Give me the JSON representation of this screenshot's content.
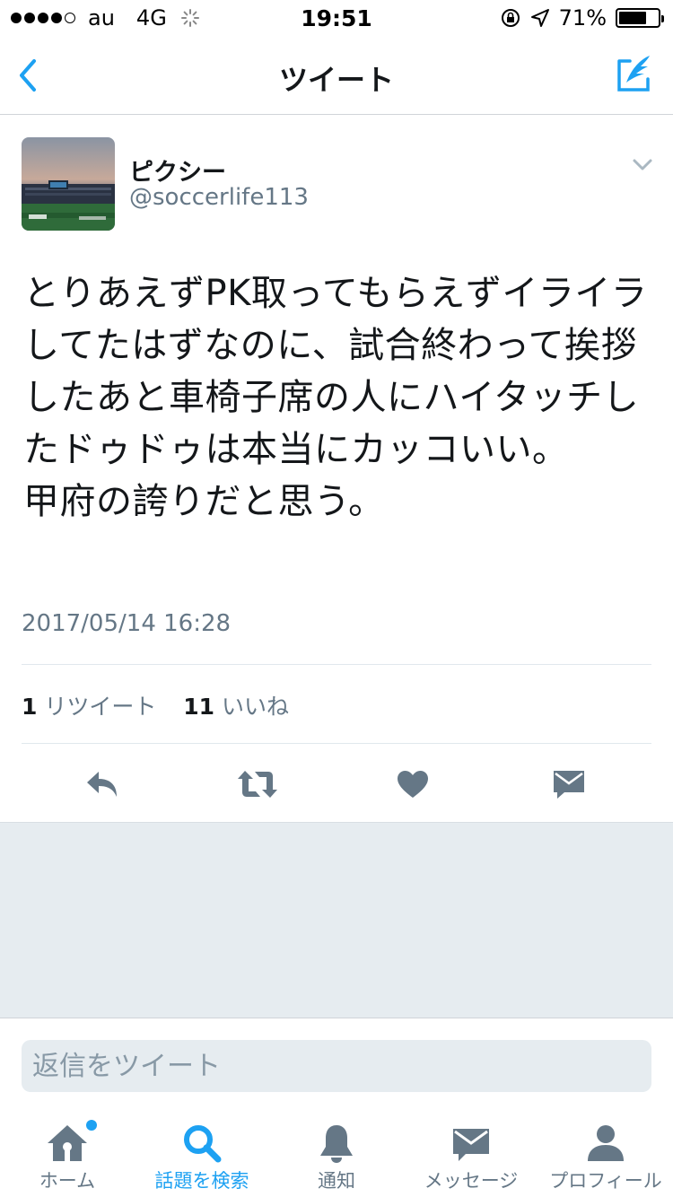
{
  "status_bar": {
    "carrier": "au",
    "network": "4G",
    "time": "19:51",
    "battery": "71%",
    "battery_level": 0.71,
    "signal_bars": 4
  },
  "nav": {
    "title": "ツイート",
    "back_icon": "chevron-left-icon",
    "compose_icon": "compose-tweet-icon"
  },
  "tweet": {
    "author_name": "ピクシー",
    "author_handle": "@soccerlife113",
    "text": "とりあえずPK取ってもらえずイライラしてたはずなのに、試合終わって挨拶したあと車椅子席の人にハイタッチしたドゥドゥは本当にカッコいい。\n甲府の誇りだと思う。",
    "timestamp": "2017/05/14 16:28",
    "retweet_count": "1",
    "retweet_label": "リツイート",
    "like_count": "11",
    "like_label": "いいね"
  },
  "reply": {
    "placeholder": "返信をツイート"
  },
  "tabs": [
    {
      "label": "ホーム",
      "icon": "home-icon"
    },
    {
      "label": "話題を検索",
      "icon": "search-icon"
    },
    {
      "label": "通知",
      "icon": "bell-icon"
    },
    {
      "label": "メッセージ",
      "icon": "envelope-icon"
    },
    {
      "label": "プロフィール",
      "icon": "profile-icon"
    }
  ],
  "colors": {
    "accent": "#1da1f2",
    "icon_gray": "#657786",
    "background_gray": "#e6ecf0"
  }
}
